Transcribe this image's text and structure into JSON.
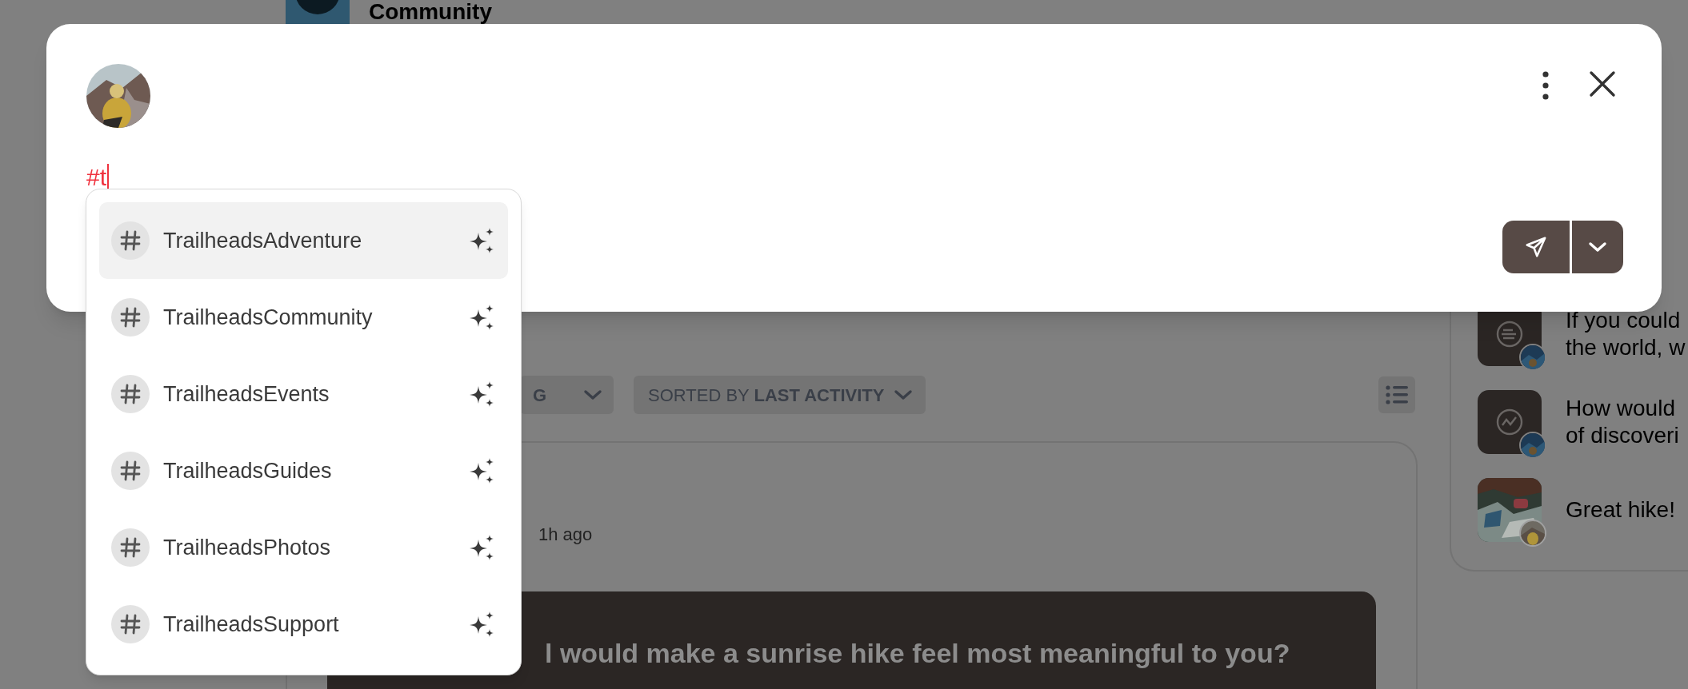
{
  "header": {
    "title": "Community"
  },
  "composer": {
    "text": "#t",
    "suggestions": [
      {
        "tag": "TrailheadsAdventure",
        "selected": true
      },
      {
        "tag": "TrailheadsCommunity",
        "selected": false
      },
      {
        "tag": "TrailheadsEvents",
        "selected": false
      },
      {
        "tag": "TrailheadsGuides",
        "selected": false
      },
      {
        "tag": "TrailheadsPhotos",
        "selected": false
      },
      {
        "tag": "TrailheadsSupport",
        "selected": false
      }
    ]
  },
  "filters": [
    {
      "label": "G"
    },
    {
      "label": "SORTED BY **LAST ACTIVITY**"
    }
  ],
  "post": {
    "time": "1h ago",
    "prompt": "l would make a sunrise hike feel most meaningful to you?"
  },
  "activity": [
    {
      "kind": "lines",
      "text": "If you could\nthe world, w"
    },
    {
      "kind": "trend",
      "text": "How would\nof discoveri"
    },
    {
      "text": "Great hike!"
    }
  ]
}
